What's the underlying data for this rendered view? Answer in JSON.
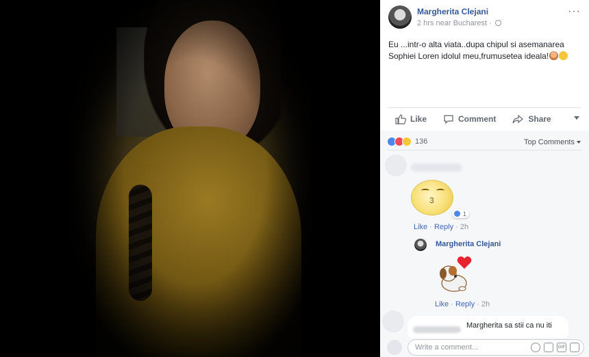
{
  "post": {
    "author": "Margherita Clejani",
    "meta": "2 hrs near Bucharest ·",
    "more": "···",
    "text": "Eu ...intr-o alta viata..dupa chipul si asemanarea Sophiei Loren idolul meu,frumusetea ideala!"
  },
  "actions": {
    "like": "Like",
    "comment": "Comment",
    "share": "Share"
  },
  "reactions": {
    "count": "136",
    "sort_label": "Top Comments"
  },
  "comment1": {
    "reaction_count": "1",
    "like": "Like",
    "reply": "Reply",
    "time": "2h"
  },
  "reply1": {
    "author": "Margherita Clejani",
    "like": "Like",
    "reply": "Reply",
    "time": "2h"
  },
  "comment2": {
    "text": "Margherita sa stii ca nu iti"
  },
  "composer": {
    "placeholder": "Write a comment...",
    "gif": "GIF"
  },
  "colors": {
    "link": "#365899",
    "accent": "#4267b2",
    "muted": "#90949c"
  }
}
